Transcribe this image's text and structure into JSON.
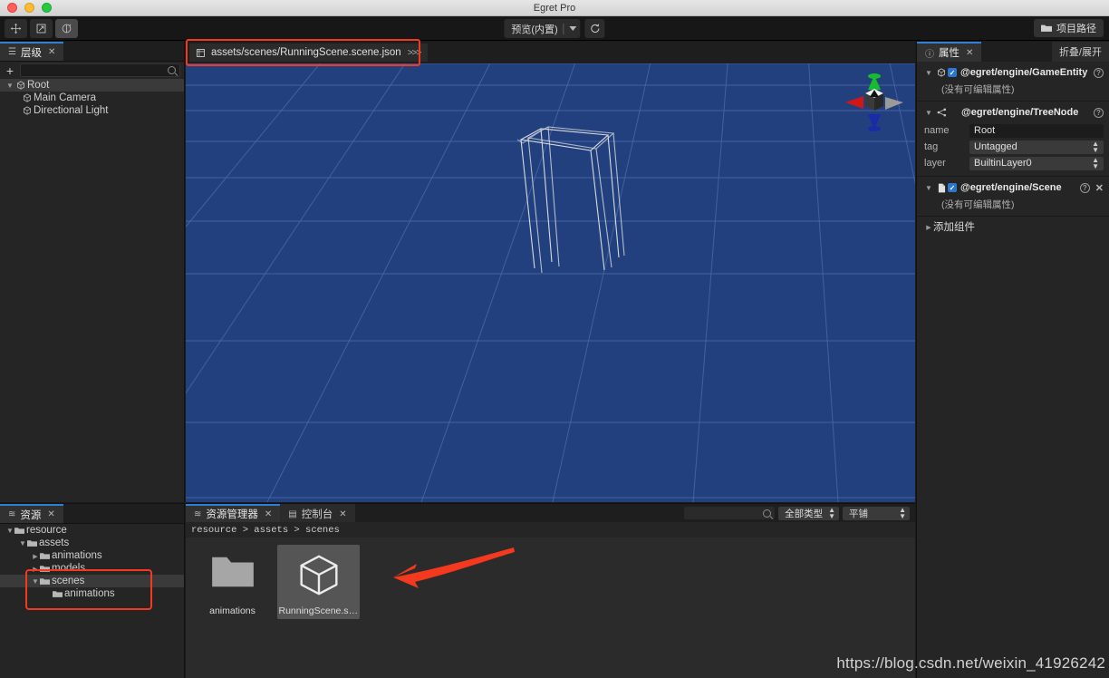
{
  "window": {
    "title": "Egret Pro"
  },
  "toolbar": {
    "tools": [
      {
        "name": "move-tool",
        "icon": "move-icon",
        "active": false
      },
      {
        "name": "scale-tool",
        "icon": "scale-icon",
        "active": false
      },
      {
        "name": "rotate-tool",
        "icon": "rotate-icon",
        "active": true
      }
    ],
    "preview_label": "预览(内置)",
    "refresh_icon": "refresh-icon",
    "project_path_label": "项目路径",
    "project_path_icon": "folder-icon"
  },
  "hierarchy": {
    "tab_label": "层级",
    "tab_icon": "list-icon",
    "add_label": "+",
    "search_placeholder": "",
    "search_value": "",
    "search_icon": "search-icon",
    "nodes": [
      {
        "label": "Root",
        "depth": 0,
        "expanded": true,
        "selected": true,
        "icon": "entity-icon"
      },
      {
        "label": "Main Camera",
        "depth": 1,
        "expanded": null,
        "selected": false,
        "icon": "entity-icon"
      },
      {
        "label": "Directional Light",
        "depth": 1,
        "expanded": null,
        "selected": false,
        "icon": "entity-icon"
      }
    ]
  },
  "scene": {
    "tab_label": "assets/scenes/RunningScene.scene.json",
    "tab_chevrons": ">>>",
    "tab_icon": "scene-icon",
    "background_color": "#22407e",
    "grid_color": "#4b69ab",
    "highlight_color": "#f4391f",
    "gizmo": {
      "up_color": "#17bb2e",
      "left_color": "#d01616",
      "right_color": "#9a9a9a",
      "down_color": "#1a2ba8",
      "cube_color": "#e2e2e2"
    }
  },
  "properties": {
    "tab_label": "属性",
    "tab_icon": "info-icon",
    "collapse_label": "折叠/展开",
    "components": [
      {
        "title": "@egret/engine/GameEntity",
        "icon": "entity-icon",
        "checked": true,
        "expanded": true,
        "hint": "(没有可编辑属性)",
        "closable": false,
        "rows": []
      },
      {
        "title": "@egret/engine/TreeNode",
        "icon": "treenode-icon",
        "checked": null,
        "expanded": true,
        "hint": "",
        "closable": false,
        "rows": [
          {
            "label": "name",
            "value": "Root",
            "type": "text"
          },
          {
            "label": "tag",
            "value": "Untagged",
            "type": "select"
          },
          {
            "label": "layer",
            "value": "BuiltinLayer0",
            "type": "select"
          }
        ]
      },
      {
        "title": "@egret/engine/Scene",
        "icon": "file-icon",
        "checked": true,
        "expanded": true,
        "hint": "(没有可编辑属性)",
        "closable": true,
        "rows": []
      }
    ],
    "add_component_label": "添加组件"
  },
  "resource_tree": {
    "tab_label": "资源",
    "tab_icon": "stack-icon",
    "nodes": [
      {
        "label": "resource",
        "depth": 0,
        "arrow": "down",
        "folder": "open",
        "selected": false
      },
      {
        "label": "assets",
        "depth": 1,
        "arrow": "down",
        "folder": "open",
        "selected": false
      },
      {
        "label": "animations",
        "depth": 2,
        "arrow": "right",
        "folder": "closed",
        "selected": false
      },
      {
        "label": "models",
        "depth": 2,
        "arrow": "right",
        "folder": "closed",
        "selected": false
      },
      {
        "label": "scenes",
        "depth": 2,
        "arrow": "down",
        "folder": "open",
        "selected": true
      },
      {
        "label": "animations",
        "depth": 3,
        "arrow": "none",
        "folder": "closed",
        "selected": false
      }
    ],
    "highlight_color": "#f4391f"
  },
  "asset_browser": {
    "tabs": [
      {
        "label": "资源管理器",
        "icon": "stack-icon",
        "selected": true,
        "closable": true
      },
      {
        "label": "控制台",
        "icon": "console-icon",
        "selected": false,
        "closable": true
      }
    ],
    "search_icon": "search-icon",
    "search_value": "",
    "filter_type_label": "全部类型",
    "layout_label": "平铺",
    "breadcrumb": "resource > assets > scenes",
    "items": [
      {
        "name": "animations",
        "type": "folder",
        "selected": false
      },
      {
        "name": "RunningScene.sce...",
        "type": "scene",
        "selected": true
      }
    ]
  },
  "annotation": {
    "arrow_color": "#f4391f",
    "watermark": "https://blog.csdn.net/weixin_41926242"
  }
}
